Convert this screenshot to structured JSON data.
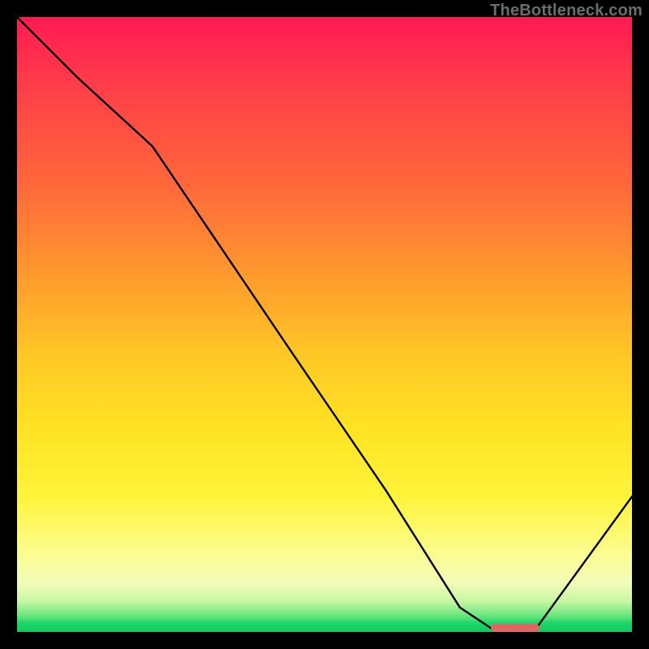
{
  "watermark": "TheBottleneck.com",
  "chart_data": {
    "type": "line",
    "title": "",
    "xlabel": "",
    "ylabel": "",
    "xlim": [
      0,
      100
    ],
    "ylim": [
      0,
      100
    ],
    "grid": false,
    "legend": false,
    "background_gradient": {
      "direction": "top_to_bottom",
      "stops": [
        {
          "pos": 0,
          "color": "#ff1a53"
        },
        {
          "pos": 28,
          "color": "#ff6a3a"
        },
        {
          "pos": 55,
          "color": "#ffc726"
        },
        {
          "pos": 78,
          "color": "#fff43a"
        },
        {
          "pos": 92,
          "color": "#f2fcb8"
        },
        {
          "pos": 97,
          "color": "#63e47b"
        },
        {
          "pos": 100,
          "color": "#12c85f"
        }
      ]
    },
    "series": [
      {
        "name": "bottleneck-curve",
        "x": [
          0,
          10,
          22,
          45,
          60,
          72,
          78,
          84,
          100
        ],
        "y": [
          100,
          90,
          79,
          45,
          23,
          4,
          0,
          0,
          22
        ]
      }
    ],
    "annotations": [
      {
        "name": "optimal-range-marker",
        "type": "h-bar",
        "x_start": 77,
        "x_end": 85,
        "y": 0.6,
        "color": "#e06666"
      }
    ]
  }
}
